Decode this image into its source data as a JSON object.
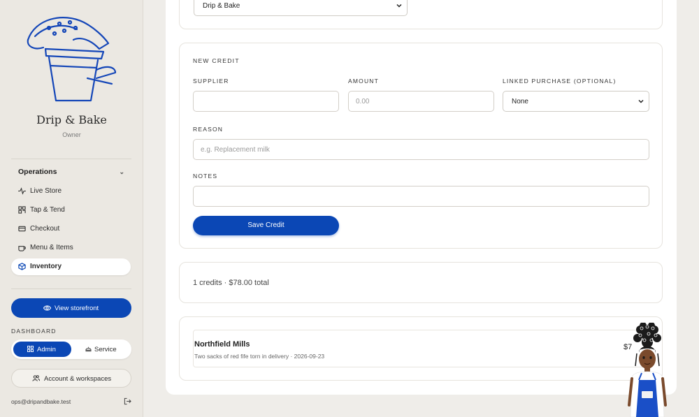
{
  "brand": {
    "name": "Drip & Bake",
    "role": "Owner"
  },
  "sidebar": {
    "section_label": "Operations",
    "items": [
      {
        "label": "Live Store",
        "icon": "pulse-icon"
      },
      {
        "label": "Tap & Tend",
        "icon": "qr-icon"
      },
      {
        "label": "Checkout",
        "icon": "card-icon"
      },
      {
        "label": "Menu & Items",
        "icon": "cup-icon"
      },
      {
        "label": "Inventory",
        "icon": "box-icon",
        "active": true
      }
    ],
    "view_storefront": "View storefront",
    "dashboard_label": "DASHBOARD",
    "mode_admin": "Admin",
    "mode_service": "Service",
    "account_button": "Account & workspaces",
    "email": "ops@dripandbake.test"
  },
  "store_select": {
    "value": "Drip & Bake"
  },
  "new_credit": {
    "title": "NEW CREDIT",
    "supplier_label": "SUPPLIER",
    "supplier_value": "",
    "amount_label": "AMOUNT",
    "amount_placeholder": "0.00",
    "linked_label": "LINKED PURCHASE (OPTIONAL)",
    "linked_value": "None",
    "reason_label": "REASON",
    "reason_placeholder": "e.g. Replacement milk",
    "notes_label": "NOTES",
    "notes_value": "",
    "save_button": "Save Credit"
  },
  "summary": {
    "text": "1 credits · $78.00 total"
  },
  "credits": [
    {
      "supplier": "Northfield Mills",
      "meta": "Two sacks of red fife torn in delivery · 2026-09-23",
      "amount": "$7"
    }
  ],
  "colors": {
    "accent": "#0b47b5",
    "sidebar_bg": "#ebe8e2",
    "page_bg": "#efede9"
  }
}
